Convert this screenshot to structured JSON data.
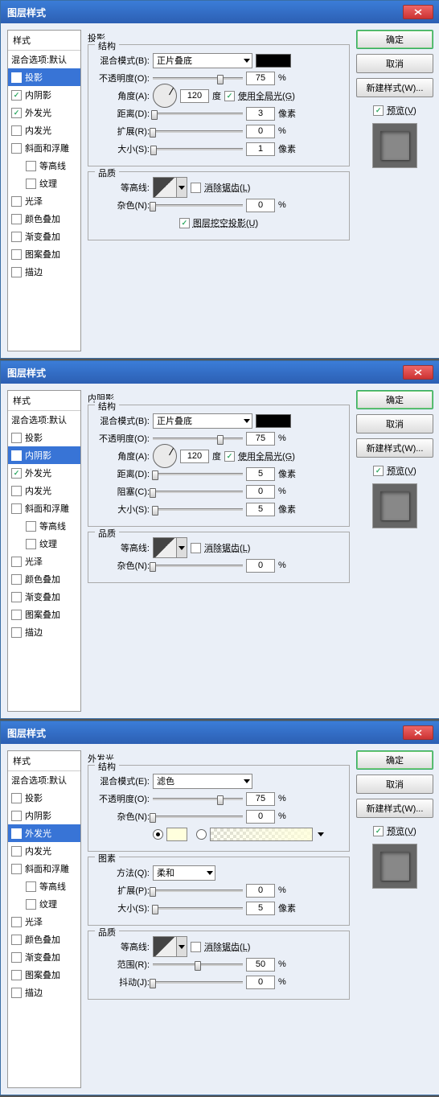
{
  "title": "图层样式",
  "btns": {
    "ok": "确定",
    "cancel": "取消",
    "newstyle": "新建样式(W)...",
    "preview": "预览(V)"
  },
  "sidebar": {
    "head": "样式",
    "blend": "混合选项:默认",
    "items": [
      "投影",
      "内阴影",
      "外发光",
      "内发光",
      "斜面和浮雕",
      "等高线",
      "纹理",
      "光泽",
      "颜色叠加",
      "渐变叠加",
      "图案叠加",
      "描边"
    ]
  },
  "labels": {
    "structure": "结构",
    "quality": "品质",
    "element": "图素",
    "blendmode": "混合模式(B):",
    "blendmodeE": "混合模式(E):",
    "opacity": "不透明度(O):",
    "angle": "角度(A):",
    "deg": "度",
    "globallight": "使用全局光(G)",
    "distance": "距离(D):",
    "spread": "扩展(R):",
    "size": "大小(S):",
    "choke": "阻塞(C):",
    "spreadP": "扩展(P):",
    "contour": "等高线:",
    "antialias": "消除锯齿(L)",
    "noise": "杂色(N):",
    "knockout": "图层挖空投影(U)",
    "method": "方法(Q):",
    "range": "范围(R):",
    "jitter": "抖动(J):",
    "px": "像素",
    "pct": "%"
  },
  "modes": {
    "multiply": "正片叠底",
    "screen": "滤色",
    "soft": "柔和"
  },
  "d0": {
    "title": "投影",
    "sel": 0,
    "checks": [
      true,
      true,
      true,
      false,
      false,
      false,
      false,
      false,
      false,
      false,
      false,
      false
    ],
    "opacity": 75,
    "angle": 120,
    "distance": 3,
    "spread": 0,
    "size": 1,
    "noise": 0,
    "knockout": true,
    "global": true,
    "anti": false
  },
  "d1": {
    "title": "内阴影",
    "sel": 1,
    "checks": [
      false,
      true,
      true,
      false,
      false,
      false,
      false,
      false,
      false,
      false,
      false,
      false
    ],
    "opacity": 75,
    "angle": 120,
    "distance": 5,
    "choke": 0,
    "size": 5,
    "noise": 0,
    "global": true,
    "anti": false
  },
  "d2": {
    "title": "外发光",
    "sel": 2,
    "checks": [
      false,
      false,
      true,
      false,
      false,
      false,
      false,
      false,
      false,
      false,
      false,
      false
    ],
    "opacity": 75,
    "noise": 0,
    "spread": 0,
    "size": 5,
    "range": 50,
    "jitter": 0,
    "anti": false,
    "color": "#ffffdd"
  }
}
